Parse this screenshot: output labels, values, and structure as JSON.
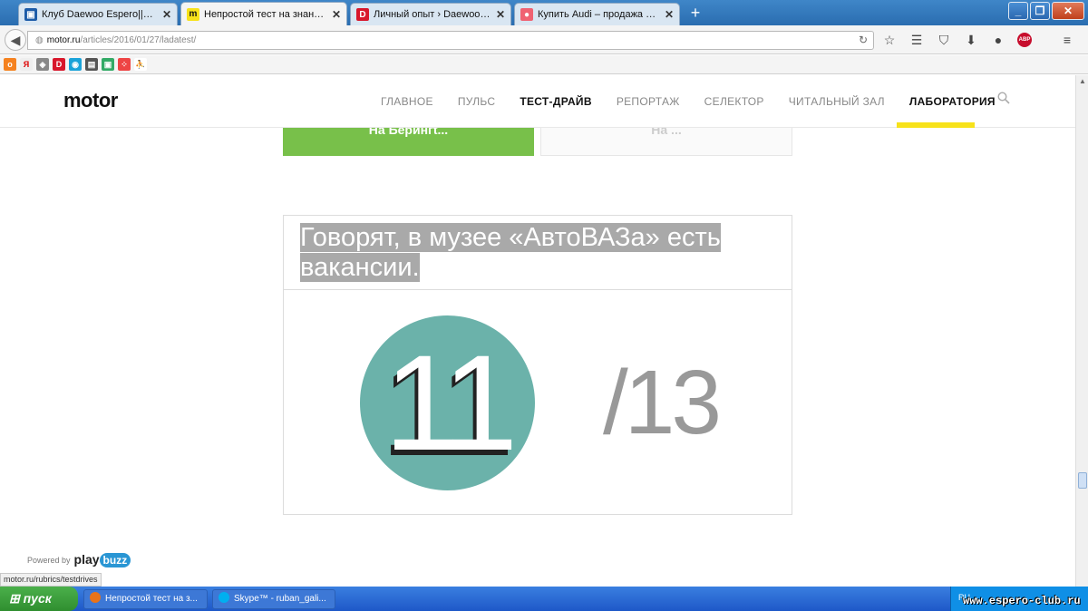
{
  "browser": {
    "tabs": [
      {
        "label": "Клуб Daewoo Espero||Кто е...",
        "favicon": "daewoo-icon",
        "active": false
      },
      {
        "label": "Непростой тест на знание а...",
        "favicon": "motor-m-icon",
        "active": true
      },
      {
        "label": "Личный опыт › Daewoo Espe...",
        "favicon": "drive2-d-icon",
        "active": false
      },
      {
        "label": "Купить Audi – продажа под...",
        "favicon": "avito-icon",
        "active": false
      }
    ],
    "new_tab_label": "+",
    "url_domain": "motor.ru",
    "url_path": "/articles/2016/01/27/ladatest/",
    "abp_label": "ABP",
    "colors": {
      "tabbar": "#2a6db0",
      "toolbar": "#f4f4f4"
    }
  },
  "site": {
    "logo": "motor",
    "menu": [
      {
        "label": "ГЛАВНОЕ",
        "bold": false
      },
      {
        "label": "ПУЛЬС",
        "bold": false
      },
      {
        "label": "ТЕСТ-ДРАЙВ",
        "bold": true
      },
      {
        "label": "РЕПОРТАЖ",
        "bold": false
      },
      {
        "label": "СЕЛЕКТОР",
        "bold": false
      },
      {
        "label": "ЧИТАЛЬНЫЙ ЗАЛ",
        "bold": false
      },
      {
        "label": "ЛАБОРАТОРИЯ",
        "bold": true,
        "active": true
      }
    ],
    "accent_color": "#f7e21a"
  },
  "quiz": {
    "answer_left": "На Берингt...",
    "answer_right": "На ...",
    "answer_left_color": "#78c04a",
    "result_title": "Говорят, в музее «АвтоВАЗа» есть вакансии.",
    "score": "11",
    "total": "/13",
    "score_circle_color": "#6bb2aa"
  },
  "footer": {
    "powered_by": "Powered by",
    "play": "play",
    "buzz": "buzz"
  },
  "status_url": "motor.ru/rubrics/testdrives",
  "taskbar": {
    "start_label": "пуск",
    "tasks": [
      {
        "label": "Непростой тест на з...",
        "icon": "firefox-icon"
      },
      {
        "label": "Skype™ - ruban_gali...",
        "icon": "skype-icon"
      }
    ],
    "tray_lang": "RU",
    "watermark": "www.espero-club.ru"
  }
}
